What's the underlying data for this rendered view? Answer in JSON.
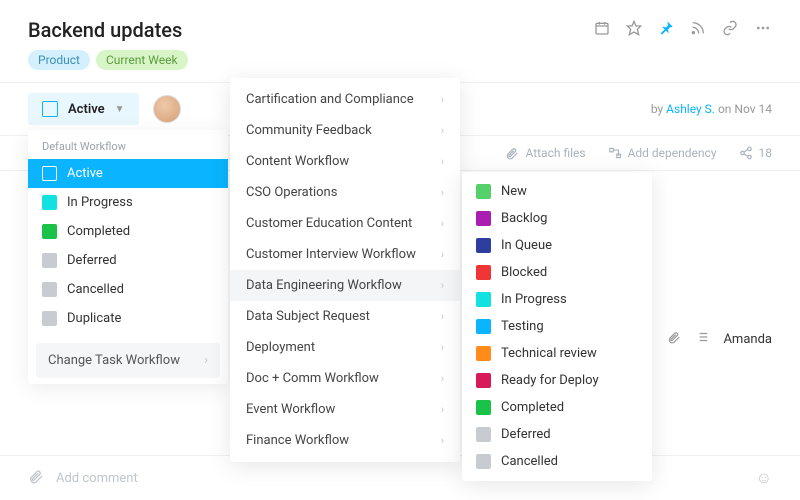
{
  "header": {
    "title": "Backend updates",
    "tags": {
      "product": "Product",
      "week": "Current Week"
    }
  },
  "status": {
    "current": "Active",
    "byline_prefix": "by",
    "author": "Ashley S.",
    "date_prefix": "on",
    "date": "Nov 14"
  },
  "meta": {
    "attach": "Attach files",
    "dependency": "Add dependency",
    "count": "18"
  },
  "assignee": {
    "name": "Amanda"
  },
  "comment": {
    "placeholder": "Add comment"
  },
  "status_list": {
    "header": "Default Workflow",
    "items": [
      {
        "label": "Active",
        "color": "#0ab4ff",
        "selected": true
      },
      {
        "label": "In Progress",
        "color": "#11e1e1"
      },
      {
        "label": "Completed",
        "color": "#1bc24a"
      },
      {
        "label": "Deferred",
        "color": "#c8ccd1"
      },
      {
        "label": "Cancelled",
        "color": "#c8ccd1"
      },
      {
        "label": "Duplicate",
        "color": "#c8ccd1"
      }
    ],
    "change": "Change Task Workflow"
  },
  "workflows": {
    "items": [
      {
        "label": "Cartification and Compliance"
      },
      {
        "label": "Community Feedback"
      },
      {
        "label": "Content Workflow"
      },
      {
        "label": "CSO Operations"
      },
      {
        "label": "Customer Education Content"
      },
      {
        "label": "Customer Interview Workflow"
      },
      {
        "label": "Data Engineering Workflow",
        "hovered": true
      },
      {
        "label": "Data Subject Request"
      },
      {
        "label": "Deployment"
      },
      {
        "label": "Doc + Comm Workflow"
      },
      {
        "label": "Event Workflow"
      },
      {
        "label": "Finance Workflow"
      }
    ]
  },
  "substatus": {
    "items": [
      {
        "label": "New",
        "color": "#55d06a"
      },
      {
        "label": "Backlog",
        "color": "#a91db0"
      },
      {
        "label": "In Queue",
        "color": "#2e3e9e"
      },
      {
        "label": "Blocked",
        "color": "#ef3535"
      },
      {
        "label": "In Progress",
        "color": "#11e1e1"
      },
      {
        "label": "Testing",
        "color": "#0ab4ff"
      },
      {
        "label": "Technical review",
        "color": "#ff8c1a"
      },
      {
        "label": "Ready for Deploy",
        "color": "#d61a5a"
      },
      {
        "label": "Completed",
        "color": "#1bc24a"
      },
      {
        "label": "Deferred",
        "color": "#c8ccd1"
      },
      {
        "label": "Cancelled",
        "color": "#c8ccd1"
      }
    ]
  }
}
